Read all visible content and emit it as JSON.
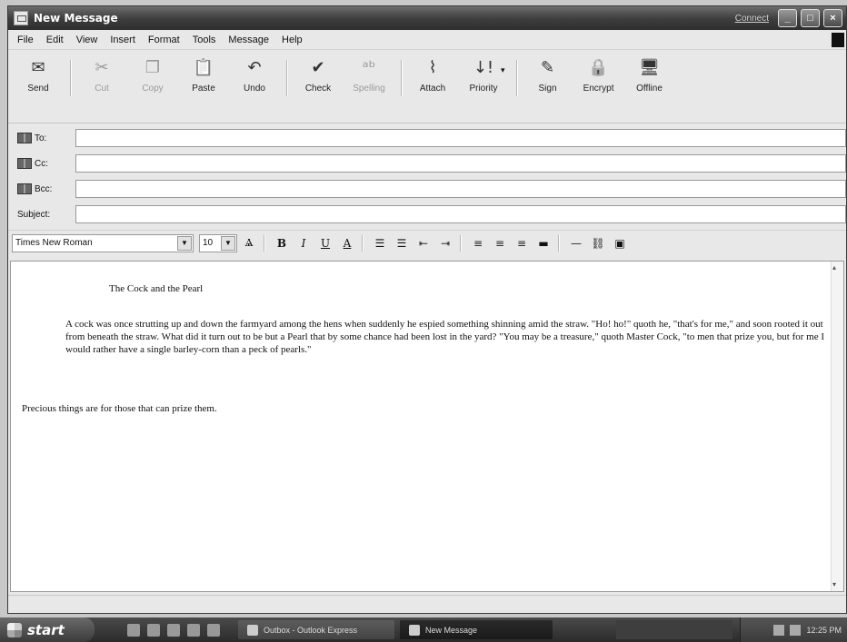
{
  "window": {
    "title": "New Message",
    "connect_link": "Connect"
  },
  "menu": [
    "File",
    "Edit",
    "View",
    "Insert",
    "Format",
    "Tools",
    "Message",
    "Help"
  ],
  "toolbar": {
    "send": "Send",
    "cut": "Cut",
    "copy": "Copy",
    "paste": "Paste",
    "undo": "Undo",
    "check": "Check",
    "spelling": "Spelling",
    "attach": "Attach",
    "priority": "Priority",
    "sign": "Sign",
    "encrypt": "Encrypt",
    "offline": "Offline"
  },
  "fields": {
    "to_label": "To:",
    "cc_label": "Cc:",
    "bcc_label": "Bcc:",
    "subject_label": "Subject:",
    "to_value": "",
    "cc_value": "",
    "bcc_value": "",
    "subject_value": ""
  },
  "format": {
    "font": "Times New Roman",
    "size": "10"
  },
  "message": {
    "title": "The Cock and the Pearl",
    "paragraph": "A cock was once strutting up and down the farmyard among the hens when suddenly he espied something shinning amid the straw. \"Ho! ho!\" quoth he, \"that's for me,\" and soon rooted it out from beneath the straw. What did it turn out to be but a Pearl that by some chance had been lost in the yard? \"You may be a treasure,\" quoth Master Cock, \"to men that prize you, but for me I would rather have a single barley-corn than a peck of pearls.\"",
    "moral": "Precious things are for those that can prize them."
  },
  "taskbar": {
    "start": "start",
    "task1": "Outbox - Outlook Express",
    "task2": "New Message",
    "clock": "12:25 PM"
  }
}
